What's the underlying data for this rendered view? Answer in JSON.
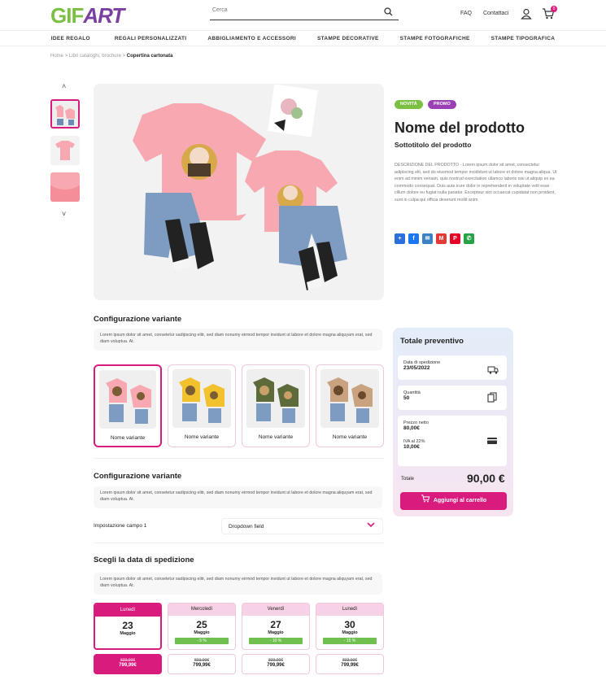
{
  "header": {
    "logo_gif": "GIF",
    "logo_art": "ART",
    "search_placeholder": "Cerca",
    "faq": "FAQ",
    "contact": "Contattaci",
    "cart_count": "0"
  },
  "nav": [
    "IDEE REGALO",
    "REGALI PERSONALIZZATI",
    "ABBIGLIAMENTO E ACCESSORI",
    "STAMPE DECORATIVE",
    "STAMPE FOTOGRAFICHE",
    "STAMPE TIPOGRAFICA"
  ],
  "breadcrumb": {
    "home": "Home",
    "sep": ">",
    "section": "Libri cataloghi, brochure",
    "current": "Copertina cartonata"
  },
  "product": {
    "tag_new": "NOVITÀ",
    "tag_promo": "PROMO",
    "title": "Nome del prodotto",
    "subtitle": "Sottotitolo del prodotto",
    "description": "DESCRIZIONE DEL PRODOTTO - Lorem ipsum dolor sit amet, consectetur adipiscing elit, sed do eiusmod tempor incididunt ut labore et dolore magna aliqua. Ut enim ad minim veniam, quis nostrud exercitation ullamco laboris nisi ut aliquip ex ea commodo consequat. Duis aute irure dolor in reprehenderit in voluptate velit esse cillum dolore eu fugiat nulla pariatur. Excepteur sint occaecat cupidatat non proident, sunt in culpa qui officia deserunt mollit anim"
  },
  "share_icons": [
    {
      "name": "share-plus-icon",
      "glyph": "+",
      "color": "#2a6fdb"
    },
    {
      "name": "facebook-icon",
      "glyph": "f",
      "color": "#1877f2"
    },
    {
      "name": "email-icon",
      "glyph": "✉",
      "color": "#3b82c4"
    },
    {
      "name": "gmail-icon",
      "glyph": "M",
      "color": "#e53935"
    },
    {
      "name": "pinterest-icon",
      "glyph": "P",
      "color": "#e60023"
    },
    {
      "name": "whatsapp-icon",
      "glyph": "✆",
      "color": "#25a244"
    }
  ],
  "config1": {
    "title": "Configurazione variante",
    "text": "Lorem ipsum dolor sit amet, consetetur sadipscing elitr, sed diam nonumy eirmod tempor invidunt ut labore et dolore magna aliquyam erat, sed diam voluptua. At.",
    "variants": [
      {
        "label": "Nome variante",
        "color": "#f7a8b0"
      },
      {
        "label": "Nome variante",
        "color": "#f2c12e"
      },
      {
        "label": "Nome variante",
        "color": "#5d6b3a"
      },
      {
        "label": "Nome variante",
        "color": "#c9a37f"
      }
    ]
  },
  "config2": {
    "title": "Configurazione variante",
    "text": "Lorem ipsum dolor sit amet, consetetur sadipscing elitr, sed diam nonumy eirmod tempor invidunt ut labore et dolore magna aliquyam erat, sed diam voluptua. At.",
    "field_label": "Impostazione campo 1",
    "dropdown_value": "Dropdown field"
  },
  "shipping": {
    "title": "Scegli la data di spedizione",
    "text": "Lorem ipsum dolor sit amet, consetetur sadipscing elitr, sed diam nonumy eirmod tempor invidunt ut labore et dolore magna aliquyam erat, sed diam voluptua. At.",
    "dates": [
      {
        "day": "Lunedì",
        "num": "23",
        "month": "Maggio",
        "discount": "",
        "old": "833,00€",
        "price": "799,99€"
      },
      {
        "day": "Mercoledì",
        "num": "25",
        "month": "Maggio",
        "discount": "- 5 %",
        "old": "833,00€",
        "price": "799,99€"
      },
      {
        "day": "Venerdì",
        "num": "27",
        "month": "Maggio",
        "discount": "- 10 %",
        "old": "833,00€",
        "price": "799,99€"
      },
      {
        "day": "Lunedì",
        "num": "30",
        "month": "Maggio",
        "discount": "- 15 %",
        "old": "833,00€",
        "price": "799,99€"
      }
    ]
  },
  "summary": {
    "title": "Totale preventivo",
    "ship_label": "Data di spedizione",
    "ship_value": "23/05/2022",
    "qty_label": "Quantità",
    "qty_value": "50",
    "net_label": "Prezzo netto",
    "net_value": "80,00€",
    "vat_label": "IVA al 22%",
    "vat_value": "10,00€",
    "total_label": "Totale",
    "total_value": "90,00 €",
    "add_button": "Aggiungi al carrello"
  },
  "colors": {
    "accent": "#d81b7d",
    "green": "#7bc043",
    "purple": "#9b3fb5"
  }
}
